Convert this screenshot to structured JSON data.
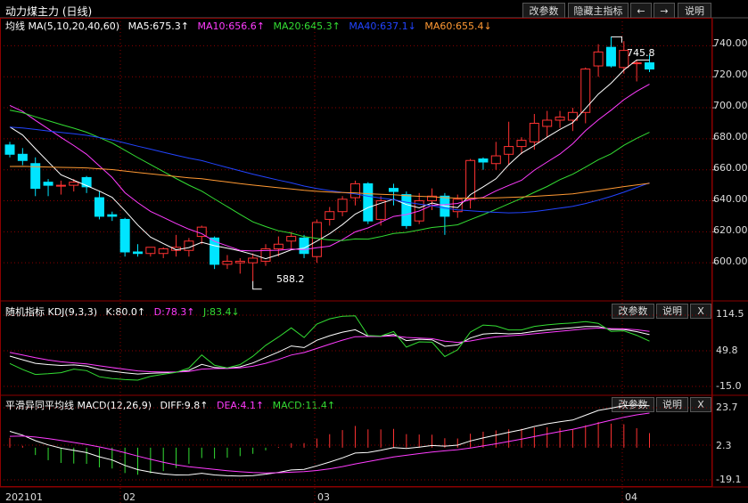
{
  "header": {
    "title": "动力煤主力 (日线)",
    "btn_params": "改参数",
    "btn_hide": "隐藏主指标",
    "btn_left": "←",
    "btn_right": "→",
    "btn_help": "说明"
  },
  "main_panel": {
    "name": "均线 MA(5,10,20,40,60)",
    "ma5": "MA5:675.3↑",
    "ma10": "MA10:656.6↑",
    "ma20": "MA20:645.3↑",
    "ma40": "MA40:637.1↓",
    "ma60": "MA60:655.4↓",
    "high_label": "745.8",
    "low_label": "588.2",
    "y_ticks": [
      "740.00",
      "720.00",
      "700.00",
      "680.00",
      "660.00",
      "640.00",
      "620.00",
      "600.00"
    ]
  },
  "kdj_panel": {
    "name": "随机指标 KDJ(9,3,3)",
    "k": "K:80.0↑",
    "d": "D:78.3↑",
    "j": "J:83.4↓",
    "btn_params": "改参数",
    "btn_help": "说明",
    "btn_close": "X",
    "y_ticks": [
      "114.5",
      "49.8",
      "-15.0"
    ]
  },
  "macd_panel": {
    "name": "平滑异同平均线 MACD(12,26,9)",
    "diff": "DIFF:9.8↑",
    "dea": "DEA:4.1↑",
    "macd": "MACD:11.4↑",
    "btn_params": "改参数",
    "btn_help": "说明",
    "btn_close": "X",
    "y_ticks": [
      "23.7",
      "2.3",
      "-19.1"
    ]
  },
  "x_axis": {
    "labels": [
      "202101",
      "02",
      "03",
      "04"
    ]
  },
  "colors": {
    "up": "#ff3232",
    "down": "#00e4ff",
    "ma5": "#ffffff",
    "ma10": "#ff3cff",
    "ma20": "#33dd33",
    "ma40": "#2244ff",
    "ma60": "#ff9933",
    "grid": "#8b0000"
  },
  "chart_data": {
    "type": "candlestick",
    "price_ylim": [
      580,
      750
    ],
    "candles": [
      {
        "o": 676,
        "h": 678,
        "l": 668,
        "c": 670
      },
      {
        "o": 670,
        "h": 674,
        "l": 663,
        "c": 666
      },
      {
        "o": 664,
        "h": 668,
        "l": 643,
        "c": 648
      },
      {
        "o": 652,
        "h": 654,
        "l": 643,
        "c": 650
      },
      {
        "o": 650,
        "h": 653,
        "l": 644,
        "c": 650
      },
      {
        "o": 650,
        "h": 654,
        "l": 646,
        "c": 652
      },
      {
        "o": 655,
        "h": 656,
        "l": 645,
        "c": 649
      },
      {
        "o": 642,
        "h": 646,
        "l": 628,
        "c": 630
      },
      {
        "o": 631,
        "h": 633,
        "l": 627,
        "c": 630
      },
      {
        "o": 628,
        "h": 629,
        "l": 604,
        "c": 607
      },
      {
        "o": 607,
        "h": 612,
        "l": 604,
        "c": 606
      },
      {
        "o": 606,
        "h": 610,
        "l": 604,
        "c": 610
      },
      {
        "o": 606,
        "h": 610,
        "l": 603,
        "c": 609
      },
      {
        "o": 608,
        "h": 618,
        "l": 604,
        "c": 610
      },
      {
        "o": 608,
        "h": 616,
        "l": 604,
        "c": 614
      },
      {
        "o": 617,
        "h": 624,
        "l": 612,
        "c": 623
      },
      {
        "o": 616,
        "h": 617,
        "l": 596,
        "c": 599
      },
      {
        "o": 599,
        "h": 605,
        "l": 596,
        "c": 601
      },
      {
        "o": 600,
        "h": 603,
        "l": 593,
        "c": 601
      },
      {
        "o": 600,
        "h": 606,
        "l": 588,
        "c": 603
      },
      {
        "o": 601,
        "h": 612,
        "l": 598,
        "c": 609
      },
      {
        "o": 609,
        "h": 617,
        "l": 604,
        "c": 612
      },
      {
        "o": 614,
        "h": 620,
        "l": 609,
        "c": 617
      },
      {
        "o": 616,
        "h": 618,
        "l": 603,
        "c": 606
      },
      {
        "o": 604,
        "h": 628,
        "l": 600,
        "c": 626
      },
      {
        "o": 628,
        "h": 636,
        "l": 624,
        "c": 633
      },
      {
        "o": 633,
        "h": 643,
        "l": 630,
        "c": 641
      },
      {
        "o": 642,
        "h": 653,
        "l": 637,
        "c": 651
      },
      {
        "o": 651,
        "h": 652,
        "l": 625,
        "c": 627
      },
      {
        "o": 628,
        "h": 643,
        "l": 624,
        "c": 640
      },
      {
        "o": 648,
        "h": 651,
        "l": 637,
        "c": 646
      },
      {
        "o": 644,
        "h": 646,
        "l": 622,
        "c": 624
      },
      {
        "o": 627,
        "h": 645,
        "l": 625,
        "c": 640
      },
      {
        "o": 640,
        "h": 648,
        "l": 634,
        "c": 643
      },
      {
        "o": 643,
        "h": 645,
        "l": 618,
        "c": 630
      },
      {
        "o": 633,
        "h": 644,
        "l": 629,
        "c": 641
      },
      {
        "o": 641,
        "h": 667,
        "l": 635,
        "c": 666
      },
      {
        "o": 667,
        "h": 668,
        "l": 660,
        "c": 665
      },
      {
        "o": 664,
        "h": 678,
        "l": 660,
        "c": 669
      },
      {
        "o": 670,
        "h": 691,
        "l": 663,
        "c": 675
      },
      {
        "o": 675,
        "h": 681,
        "l": 670,
        "c": 679
      },
      {
        "o": 678,
        "h": 696,
        "l": 673,
        "c": 690
      },
      {
        "o": 688,
        "h": 698,
        "l": 681,
        "c": 692
      },
      {
        "o": 692,
        "h": 698,
        "l": 687,
        "c": 694
      },
      {
        "o": 692,
        "h": 700,
        "l": 685,
        "c": 697
      },
      {
        "o": 697,
        "h": 726,
        "l": 690,
        "c": 725
      },
      {
        "o": 727,
        "h": 741,
        "l": 720,
        "c": 736
      },
      {
        "o": 739,
        "h": 745.8,
        "l": 726,
        "c": 727
      },
      {
        "o": 726,
        "h": 743,
        "l": 722,
        "c": 737
      },
      {
        "o": 729,
        "h": 731,
        "l": 717,
        "c": 729
      },
      {
        "o": 729,
        "h": 734,
        "l": 723,
        "c": 725
      }
    ]
  }
}
